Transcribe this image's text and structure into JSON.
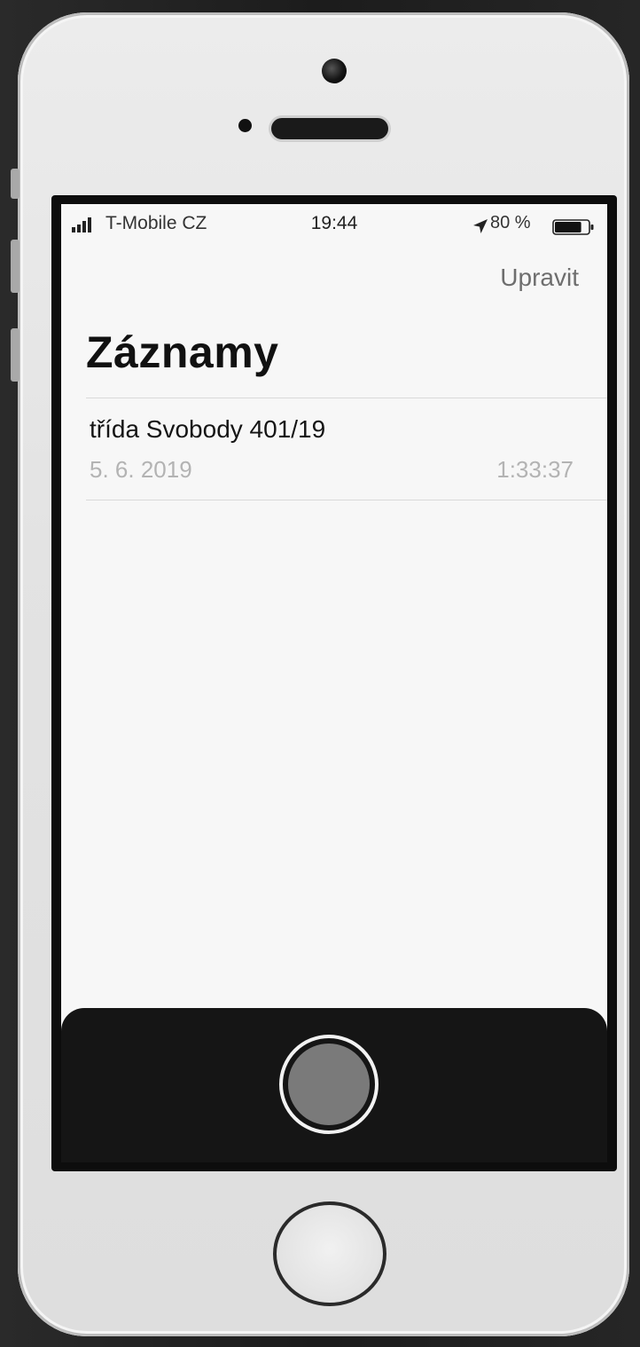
{
  "status_bar": {
    "signal_icon": "signal-bars-icon",
    "carrier": "T-Mobile CZ",
    "time": "19:44",
    "location_icon": "location-arrow-icon",
    "battery_percent": "80 %",
    "battery_level": 0.8,
    "battery_icon": "battery-icon"
  },
  "nav": {
    "edit_label": "Upravit"
  },
  "page": {
    "title": "Záznamy"
  },
  "recordings": [
    {
      "title": "třída Svobody 401/19",
      "date": "5. 6. 2019",
      "duration": "1:33:37"
    }
  ],
  "controls": {
    "record_icon": "record-circle-icon"
  },
  "device": {
    "home_button_icon": "home-button-icon",
    "camera_icon": "front-camera-icon"
  },
  "colors": {
    "screen_background": "#f7f7f7",
    "record_panel": "#151515",
    "secondary_text": "#b3b3b3",
    "edit_text": "#6e6e6e"
  }
}
